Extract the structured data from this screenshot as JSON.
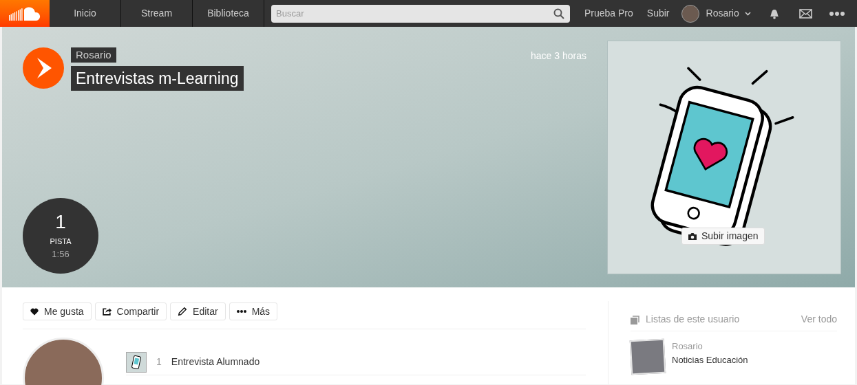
{
  "nav": {
    "items": [
      {
        "label": "Inicio"
      },
      {
        "label": "Stream"
      },
      {
        "label": "Biblioteca"
      }
    ],
    "search": {
      "placeholder": "Buscar"
    },
    "links": [
      "Prueba Pro",
      "Subir"
    ],
    "user": "Rosario"
  },
  "hero": {
    "user": "Rosario",
    "title": "Entrevistas m-Learning",
    "time": "hace 3 horas",
    "count": "1",
    "count_label": "PISTA",
    "duration": "1:56",
    "upload_button": "Subir imagen"
  },
  "actions": [
    {
      "kind": "like",
      "label": "Me gusta"
    },
    {
      "kind": "share",
      "label": "Compartir"
    },
    {
      "kind": "edit",
      "label": "Editar"
    },
    {
      "kind": "more",
      "label": "Más"
    }
  ],
  "tracks": [
    {
      "number": "1",
      "title": "Entrevista Alumnado"
    }
  ],
  "sidebar": {
    "title": "Listas de este usuario",
    "view_all": "Ver todo",
    "playlists": [
      {
        "user": "Rosario",
        "title": "Noticias Educación"
      }
    ]
  }
}
